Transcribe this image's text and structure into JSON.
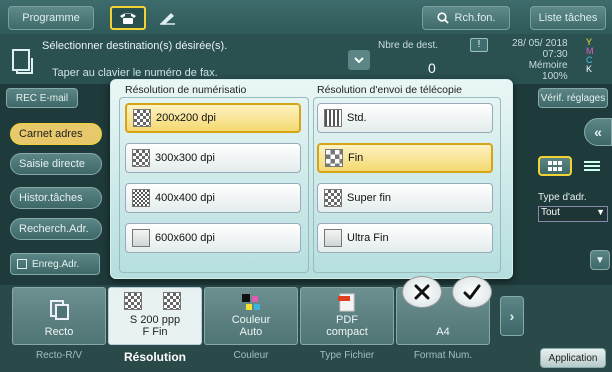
{
  "topbar": {
    "tab_programme": "Programme",
    "search_label": "Rch.fon.",
    "jobs_label": "Liste tâches"
  },
  "header": {
    "line1": "Sélectionner destination(s) désirée(s).",
    "line2": "Taper au clavier le numéro de fax.",
    "nb_dest_label": "Nbre de dest.",
    "nb_dest_value": "0",
    "date": "28/ 05/ 2018",
    "time": "07:30",
    "memory_label": "Mémoire",
    "memory_value": "100%",
    "toner_letters": [
      "Y",
      "M",
      "C",
      "K"
    ]
  },
  "left": {
    "rec_email": "REC E-mail",
    "items": [
      "Carnet adres",
      "Saisie directe",
      "Histor.tâches",
      "Recherch.Adr."
    ],
    "enreg": "Enreg.Adr."
  },
  "right": {
    "verif": "Vérif. réglages",
    "type_adr_label": "Type d'adr.",
    "type_adr_value": "Tout",
    "application": "Application"
  },
  "dialog": {
    "scan_title": "Résolution de numérisatio",
    "fax_title": "Résolution d'envoi de télécopie",
    "scan_options": [
      "200x200 dpi",
      "300x300 dpi",
      "400x400 dpi",
      "600x600 dpi"
    ],
    "scan_selected": 0,
    "fax_options": [
      "Std.",
      "Fin",
      "Super fin",
      "Ultra Fin"
    ],
    "fax_selected": 1
  },
  "bottom": {
    "cards": [
      {
        "value": "Recto",
        "label": "Recto-R/V"
      },
      {
        "value": "S 200 ppp\nF Fin",
        "label": "Résolution"
      },
      {
        "value": "Couleur\nAuto",
        "label": "Couleur"
      },
      {
        "value": "PDF\ncompact",
        "label": "Type Fichier"
      },
      {
        "value": "A4",
        "label": "Format Num."
      }
    ]
  },
  "colors": {
    "accent": "#f3d234",
    "selected_fill": "#f3d970"
  }
}
